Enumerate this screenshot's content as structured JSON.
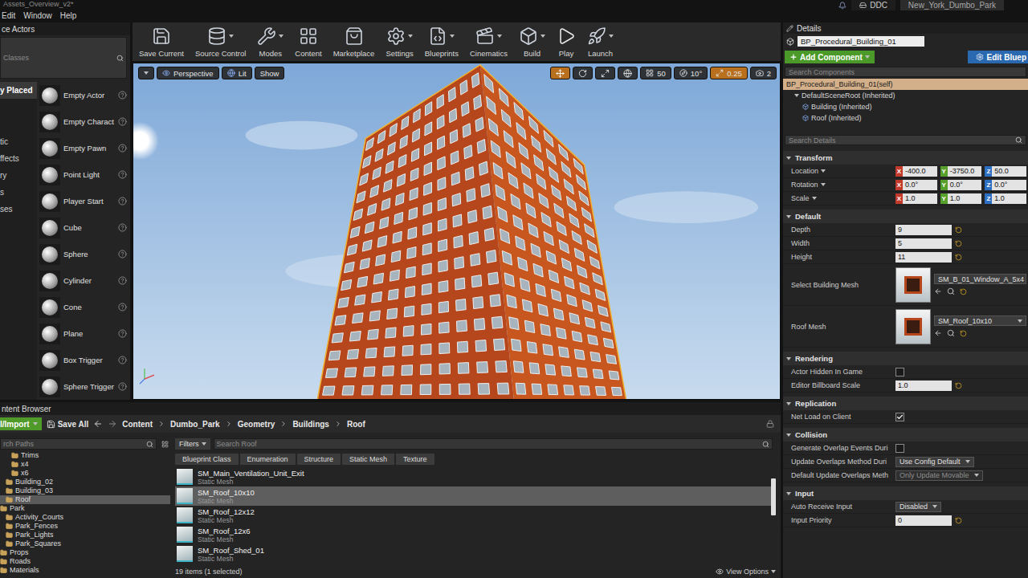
{
  "window": {
    "tab": "Assets_Overview_v2*",
    "menu": [
      "Edit",
      "Window",
      "Help"
    ],
    "tabs": [
      {
        "label": "DDC",
        "selected": false
      },
      {
        "label": "New_York_Dumbo_Park",
        "selected": true
      }
    ]
  },
  "place_actors": {
    "title": "ce Actors",
    "search": {
      "placeholder": "Classes"
    },
    "categories": [
      {
        "label": "y Placed",
        "selected": true
      },
      {
        "label": "tic",
        "selected": false
      },
      {
        "label": "ffects",
        "selected": false
      },
      {
        "label": "ry",
        "selected": false
      },
      {
        "label": "s",
        "selected": false
      },
      {
        "label": "ses",
        "selected": false
      }
    ],
    "items": [
      "Empty Actor",
      "Empty Charact",
      "Empty Pawn",
      "Point Light",
      "Player Start",
      "Cube",
      "Sphere",
      "Cylinder",
      "Cone",
      "Plane",
      "Box Trigger",
      "Sphere Trigger"
    ]
  },
  "toolbar": [
    {
      "label": "Save Current",
      "menu": false
    },
    {
      "label": "Source Control",
      "menu": true
    },
    {
      "label": "Modes",
      "menu": true
    },
    {
      "label": "Content",
      "menu": false
    },
    {
      "label": "Marketplace",
      "menu": false
    },
    {
      "label": "Settings",
      "menu": true
    },
    {
      "label": "Blueprints",
      "menu": true
    },
    {
      "label": "Cinematics",
      "menu": true
    },
    {
      "label": "Build",
      "menu": true
    },
    {
      "label": "Play",
      "menu": false
    },
    {
      "label": "Launch",
      "menu": true
    }
  ],
  "viewport": {
    "view_mode": "Perspective",
    "lighting": "Lit",
    "show": "Show",
    "snaps": [
      "50",
      "10°",
      "0.25",
      "2"
    ]
  },
  "details": {
    "title": "Details",
    "actor_name": "BP_Procedural_Building_01",
    "add_component": "Add Component",
    "edit_blueprint": "Edit Bluep",
    "component_search": {
      "placeholder": "Search Components"
    },
    "components": [
      {
        "label": "BP_Procedural_Building_01(self)",
        "depth": 0,
        "selected": true
      },
      {
        "label": "DefaultSceneRoot (Inherited)",
        "depth": 1,
        "selected": false
      },
      {
        "label": "Building (Inherited)",
        "depth": 2,
        "selected": false
      },
      {
        "label": "Roof (Inherited)",
        "depth": 2,
        "selected": false
      }
    ],
    "details_search": {
      "placeholder": "Search Details"
    },
    "sections": [
      {
        "title": "Transform",
        "expanded": true,
        "rows": [
          {
            "kind": "vector",
            "label": "Location",
            "values": [
              {
                "axis": "X",
                "value": "-400.0"
              },
              {
                "axis": "Y",
                "value": "-3750.0"
              },
              {
                "axis": "Z",
                "value": "50.0"
              }
            ]
          },
          {
            "kind": "vector",
            "label": "Rotation",
            "values": [
              {
                "axis": "X",
                "value": "0.0°"
              },
              {
                "axis": "Y",
                "value": "0.0°"
              },
              {
                "axis": "Z",
                "value": "0.0°"
              }
            ]
          },
          {
            "kind": "vector",
            "label": "Scale",
            "values": [
              {
                "axis": "X",
                "value": "1.0"
              },
              {
                "axis": "Y",
                "value": "1.0"
              },
              {
                "axis": "Z",
                "value": "1.0"
              }
            ]
          }
        ]
      },
      {
        "title": "Default",
        "expanded": true,
        "rows": [
          {
            "kind": "number",
            "label": "Depth",
            "value": "9"
          },
          {
            "kind": "number",
            "label": "Width",
            "value": "5"
          },
          {
            "kind": "number",
            "label": "Height",
            "value": "11"
          },
          {
            "kind": "asset",
            "label": "Select Building Mesh",
            "value": "SM_B_01_Window_A_5x4"
          },
          {
            "kind": "asset",
            "label": "Roof Mesh",
            "value": "SM_Roof_10x10"
          }
        ]
      },
      {
        "title": "Rendering",
        "expanded": true,
        "rows": [
          {
            "kind": "checkbox",
            "label": "Actor Hidden In Game",
            "checked": false
          },
          {
            "kind": "number",
            "label": "Editor Billboard Scale",
            "value": "1.0"
          }
        ]
      },
      {
        "title": "Replication",
        "expanded": true,
        "rows": [
          {
            "kind": "checkbox",
            "label": "Net Load on Client",
            "checked": true
          }
        ]
      },
      {
        "title": "Collision",
        "expanded": true,
        "rows": [
          {
            "kind": "checkbox",
            "label": "Generate Overlap Events Duri",
            "checked": false
          },
          {
            "kind": "dropdown",
            "label": "Update Overlaps Method Duri",
            "value": "Use Config Default",
            "disabled": false
          },
          {
            "kind": "dropdown",
            "label": "Default Update Overlaps Meth",
            "value": "Only Update Movable",
            "disabled": true
          }
        ]
      },
      {
        "title": "Input",
        "expanded": true,
        "rows": [
          {
            "kind": "dropdown",
            "label": "Auto Receive Input",
            "value": "Disabled",
            "disabled": false
          },
          {
            "kind": "number",
            "label": "Input Priority",
            "value": "0"
          }
        ]
      }
    ]
  },
  "content_browser": {
    "title": "ntent Browser",
    "import": "l/Import",
    "save_all": "Save All",
    "path": [
      "Content",
      "Dumbo_Park",
      "Geometry",
      "Buildings",
      "Roof"
    ],
    "path_search": {
      "placeholder": "rch Paths"
    },
    "folders": [
      {
        "label": "Trims",
        "depth": 2,
        "selected": false
      },
      {
        "label": "x4",
        "depth": 2,
        "selected": false
      },
      {
        "label": "x6",
        "depth": 2,
        "selected": false
      },
      {
        "label": "Building_02",
        "depth": 1,
        "selected": false
      },
      {
        "label": "Building_03",
        "depth": 1,
        "selected": false
      },
      {
        "label": "Roof",
        "depth": 1,
        "selected": true
      },
      {
        "label": "Park",
        "depth": 0,
        "selected": false
      },
      {
        "label": "Activity_Courts",
        "depth": 1,
        "selected": false
      },
      {
        "label": "Park_Fences",
        "depth": 1,
        "selected": false
      },
      {
        "label": "Park_Lights",
        "depth": 1,
        "selected": false
      },
      {
        "label": "Park_Squares",
        "depth": 1,
        "selected": false
      },
      {
        "label": "Props",
        "depth": 0,
        "selected": false
      },
      {
        "label": "Roads",
        "depth": 0,
        "selected": false
      },
      {
        "label": "Materials",
        "depth": 0,
        "selected": false
      }
    ],
    "filters": "Filters",
    "asset_search": {
      "placeholder": "Search Roof"
    },
    "filter_chips": [
      "Blueprint Class",
      "Enumeration",
      "Structure",
      "Static Mesh",
      "Texture"
    ],
    "assets": [
      {
        "name": "SM_Main_Ventilation_Unit_Exit",
        "type": "Static Mesh",
        "selected": false
      },
      {
        "name": "SM_Roof_10x10",
        "type": "Static Mesh",
        "selected": true
      },
      {
        "name": "SM_Roof_12x12",
        "type": "Static Mesh",
        "selected": false
      },
      {
        "name": "SM_Roof_12x6",
        "type": "Static Mesh",
        "selected": false
      },
      {
        "name": "SM_Roof_Shed_01",
        "type": "Static Mesh",
        "selected": false
      }
    ],
    "status": "19 items (1 selected)",
    "view_options": "View Options"
  }
}
